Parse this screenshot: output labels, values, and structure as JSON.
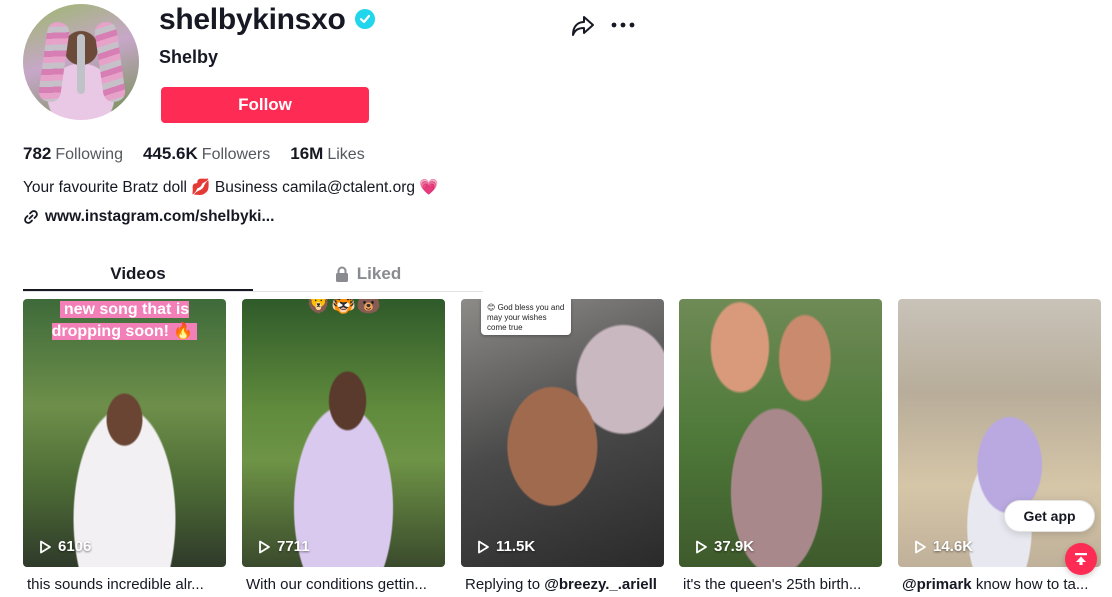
{
  "profile": {
    "username": "shelbykinsxo",
    "nickname": "Shelby",
    "verified": true,
    "follow_label": "Follow",
    "stats": {
      "following_count": "782",
      "following_label": "Following",
      "followers_count": "445.6K",
      "followers_label": "Followers",
      "likes_count": "16M",
      "likes_label": "Likes"
    },
    "bio": "Your favourite Bratz doll 💋 Business camila@ctalent.org 💗",
    "link": "www.instagram.com/shelbyki..."
  },
  "tabs": [
    {
      "label": "Videos",
      "active": true
    },
    {
      "label": "Liked",
      "locked": true
    }
  ],
  "videos": [
    {
      "plays": "6106",
      "caption": "this sounds incredible alr...",
      "overlay": "new song that is dropping soon! 🔥"
    },
    {
      "plays": "7711",
      "caption": "With our conditions gettin...",
      "overlay": "🦁🐯🐻"
    },
    {
      "plays": "11.5K",
      "caption_prefix": "Replying to ",
      "caption_mention": "@breezy._.ariell",
      "sticker": "😊 God bless you and may your wishes come true"
    },
    {
      "plays": "37.9K",
      "caption": "it's the queen's 25th birth..."
    },
    {
      "plays": "14.6K",
      "caption_mention": "@primark",
      "caption_suffix": " know how to ta..."
    }
  ],
  "floating": {
    "get_app_label": "Get app"
  },
  "colors": {
    "accent": "#fe2c55",
    "verified": "#20d5ec",
    "text_primary": "#161823",
    "text_secondary": "#55575e",
    "tab_inactive": "#8a8b91"
  }
}
